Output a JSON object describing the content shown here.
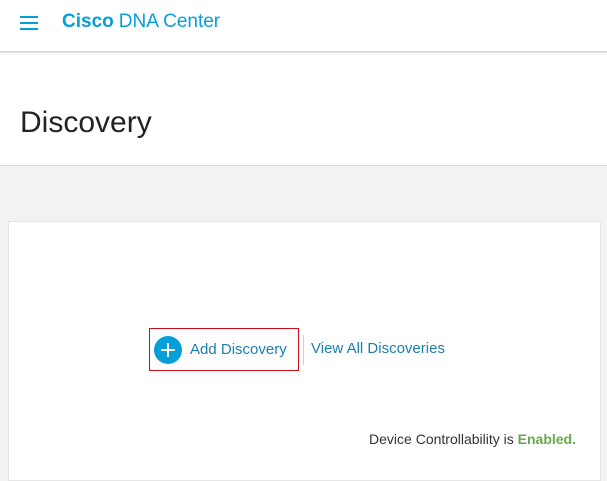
{
  "header": {
    "brand_bold": "Cisco",
    "brand_light": "DNA Center",
    "menu_icon": "hamburger-menu-icon",
    "brand_color": "#049fd9"
  },
  "page": {
    "title": "Discovery"
  },
  "actions": {
    "add_discovery_label": "Add Discovery",
    "add_icon": "plus-circle-icon",
    "view_all_label": "View All Discoveries"
  },
  "footer": {
    "controllability_prefix": "Device Controllability is",
    "controllability_status": "Enabled.",
    "status_color": "#6aa84f"
  }
}
